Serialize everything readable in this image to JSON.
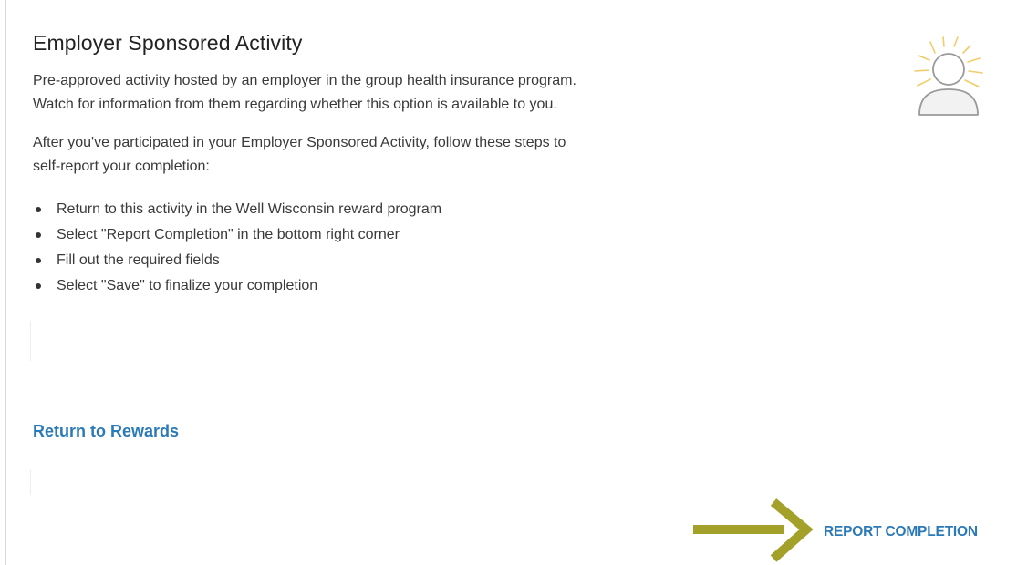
{
  "activity": {
    "title": "Employer Sponsored Activity",
    "description_line1": "Pre-approved activity hosted by an employer in the group health insurance program.",
    "description_line2": "Watch for information from them regarding whether this option is available to you.",
    "instructions_line1": "After you've participated in your Employer Sponsored Activity, follow these steps to",
    "instructions_line2": "self-report your completion:",
    "steps": [
      "Return to this activity in the Well Wisconsin reward program",
      "Select \"Report Completion\" in the bottom right corner",
      "Fill out the required fields",
      "Select \"Save\" to finalize your completion"
    ],
    "icon": "user-icon"
  },
  "links": {
    "return_label": "Return to Rewards",
    "report_label": "REPORT COMPLETION"
  },
  "colors": {
    "link": "#2b7ab8",
    "arrow": "#a3a12a",
    "sunburst": "#f0cd6a",
    "avatar": "#9a9a9a"
  }
}
